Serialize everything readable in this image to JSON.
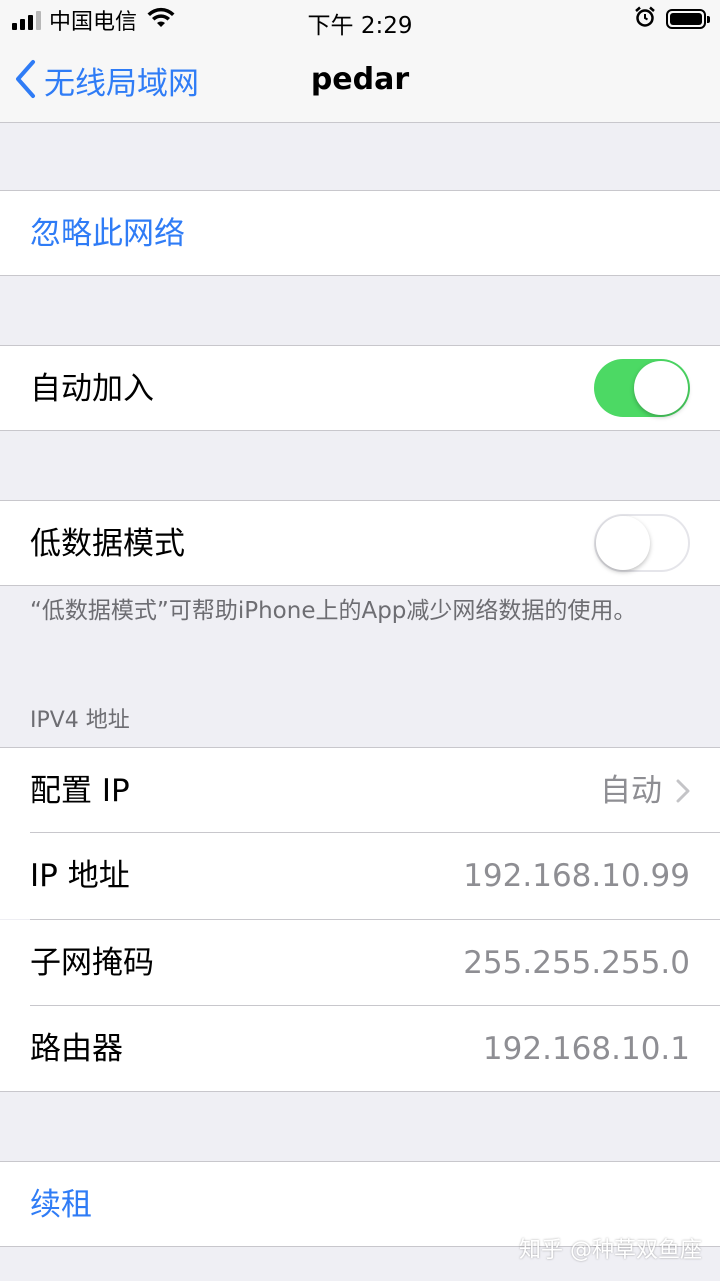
{
  "status_bar": {
    "carrier": "中国电信",
    "time": "下午 2:29"
  },
  "nav": {
    "back_label": "无线局域网",
    "title": "pedar"
  },
  "forget_network": "忽略此网络",
  "auto_join": {
    "label": "自动加入",
    "enabled": true
  },
  "low_data_mode": {
    "label": "低数据模式",
    "enabled": false,
    "footnote": "“低数据模式”可帮助iPhone上的App减少网络数据的使用。"
  },
  "ipv4": {
    "header": "IPV4 地址",
    "rows": [
      {
        "label": "配置 IP",
        "value": "自动"
      },
      {
        "label": "IP 地址",
        "value": "192.168.10.99"
      },
      {
        "label": "子网掩码",
        "value": "255.255.255.0"
      },
      {
        "label": "路由器",
        "value": "192.168.10.1"
      }
    ]
  },
  "renew_lease": "续租",
  "watermark": "知乎 @种草双鱼座",
  "colors": {
    "accent": "#2f7cf6",
    "toggle_on": "#4cd964",
    "background": "#efeff4"
  }
}
